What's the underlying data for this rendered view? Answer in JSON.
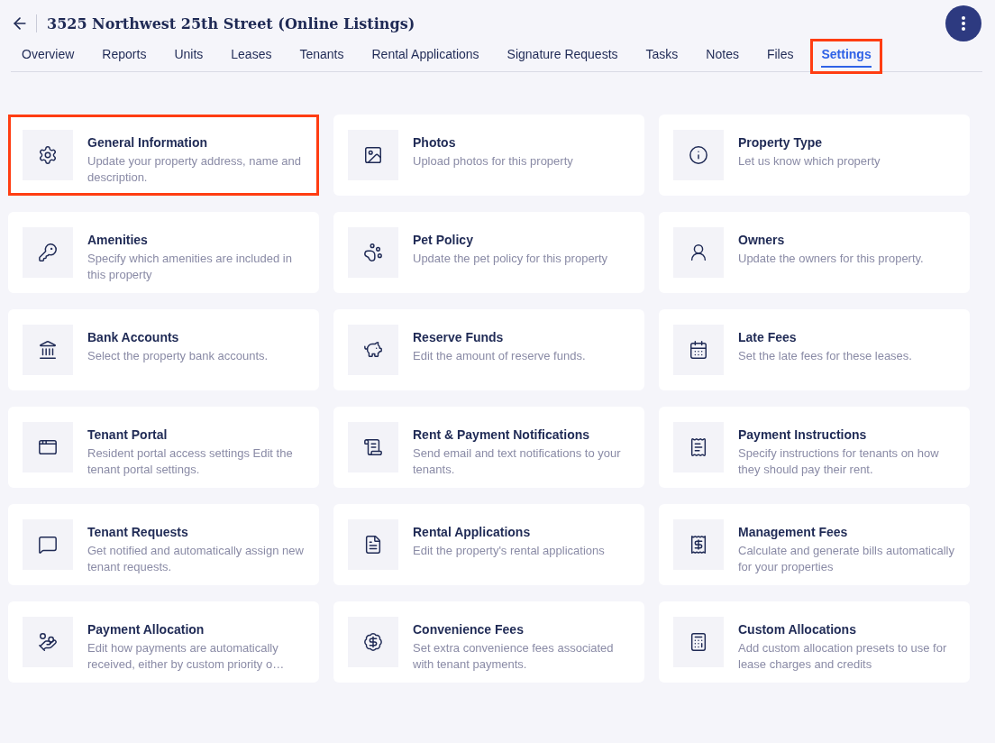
{
  "header": {
    "title": "3525 Northwest 25th Street (Online Listings)"
  },
  "tabs": [
    {
      "label": "Overview",
      "selected": false,
      "highlighted": false
    },
    {
      "label": "Reports",
      "selected": false,
      "highlighted": false
    },
    {
      "label": "Units",
      "selected": false,
      "highlighted": false
    },
    {
      "label": "Leases",
      "selected": false,
      "highlighted": false
    },
    {
      "label": "Tenants",
      "selected": false,
      "highlighted": false
    },
    {
      "label": "Rental Applications",
      "selected": false,
      "highlighted": false
    },
    {
      "label": "Signature Requests",
      "selected": false,
      "highlighted": false
    },
    {
      "label": "Tasks",
      "selected": false,
      "highlighted": false
    },
    {
      "label": "Notes",
      "selected": false,
      "highlighted": false
    },
    {
      "label": "Files",
      "selected": false,
      "highlighted": false
    },
    {
      "label": "Settings",
      "selected": true,
      "highlighted": true
    }
  ],
  "cards": [
    {
      "title": "General Information",
      "description": "Update your property address, name and description.",
      "highlighted": true
    },
    {
      "title": "Photos",
      "description": "Upload photos for this property",
      "highlighted": false
    },
    {
      "title": "Property Type",
      "description": "Let us know which property",
      "highlighted": false
    },
    {
      "title": "Amenities",
      "description": "Specify which amenities are included in this property",
      "highlighted": false
    },
    {
      "title": "Pet Policy",
      "description": "Update the pet policy for this property",
      "highlighted": false
    },
    {
      "title": "Owners",
      "description": "Update the owners for this property.",
      "highlighted": false
    },
    {
      "title": "Bank Accounts",
      "description": "Select the property bank accounts.",
      "highlighted": false
    },
    {
      "title": "Reserve Funds",
      "description": "Edit the amount of reserve funds.",
      "highlighted": false
    },
    {
      "title": "Late Fees",
      "description": "Set the late fees for these leases.",
      "highlighted": false
    },
    {
      "title": "Tenant Portal",
      "description": "Resident portal access settings Edit the tenant portal settings.",
      "highlighted": false
    },
    {
      "title": "Rent & Payment Notifications",
      "description": "Send email and text notifications to your tenants.",
      "highlighted": false
    },
    {
      "title": "Payment Instructions",
      "description": "Specify instructions for tenants on how they should pay their rent.",
      "highlighted": false
    },
    {
      "title": "Tenant Requests",
      "description": "Get notified and automatically assign new tenant requests.",
      "highlighted": false
    },
    {
      "title": "Rental Applications",
      "description": "Edit the property's rental applications",
      "highlighted": false
    },
    {
      "title": "Management Fees",
      "description": "Calculate and generate bills automatically for your properties",
      "highlighted": false
    },
    {
      "title": "Payment Allocation",
      "description": "Edit how payments are automatically received, either by custom priority o…",
      "highlighted": false
    },
    {
      "title": "Convenience Fees",
      "description": "Set extra convenience fees associated with tenant payments.",
      "highlighted": false
    },
    {
      "title": "Custom Allocations",
      "description": "Add custom allocation presets to use for lease charges and credits",
      "highlighted": false
    }
  ]
}
